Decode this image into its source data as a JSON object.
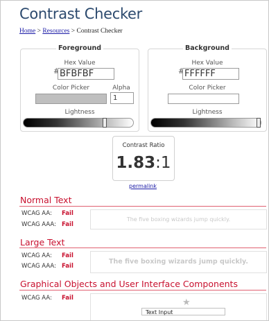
{
  "page": {
    "title": "Contrast Checker"
  },
  "breadcrumb": {
    "home": "Home",
    "sep1": " > ",
    "resources": "Resources",
    "sep2": " > ",
    "current": "Contrast Checker"
  },
  "foreground": {
    "heading": "Foreground",
    "hex_label": "Hex Value",
    "hash": "#",
    "hex_value": "BFBFBF",
    "picker_label": "Color Picker",
    "alpha_label": "Alpha",
    "alpha_value": "1",
    "lightness_label": "Lightness",
    "swatch_color": "#bfbfbf",
    "lightness_level": 0.75
  },
  "background": {
    "heading": "Background",
    "hex_label": "Hex Value",
    "hash": "#",
    "hex_value": "FFFFFF",
    "picker_label": "Color Picker",
    "lightness_label": "Lightness",
    "swatch_color": "#ffffff",
    "lightness_level": 1.0
  },
  "result": {
    "label": "Contrast Ratio",
    "ratio_main": "1.83",
    "ratio_suffix": ":1",
    "permalink": "permalink"
  },
  "normal_text": {
    "heading": "Normal Text",
    "aa_label": "WCAG AA:",
    "aa_result": "Fail",
    "aaa_label": "WCAG AAA:",
    "aaa_result": "Fail",
    "sample": "The five boxing wizards jump quickly."
  },
  "large_text": {
    "heading": "Large Text",
    "aa_label": "WCAG AA:",
    "aa_result": "Fail",
    "aaa_label": "WCAG AAA:",
    "aaa_result": "Fail",
    "sample": "The five boxing wizards jump quickly."
  },
  "graphical": {
    "heading": "Graphical Objects and User Interface Components",
    "aa_label": "WCAG AA:",
    "aa_result": "Fail",
    "star_icon": "star-icon",
    "input_text": "Text Input"
  },
  "colors": {
    "accent": "#c8102e",
    "title": "#2c4a6e",
    "link": "#1a1aa6"
  }
}
